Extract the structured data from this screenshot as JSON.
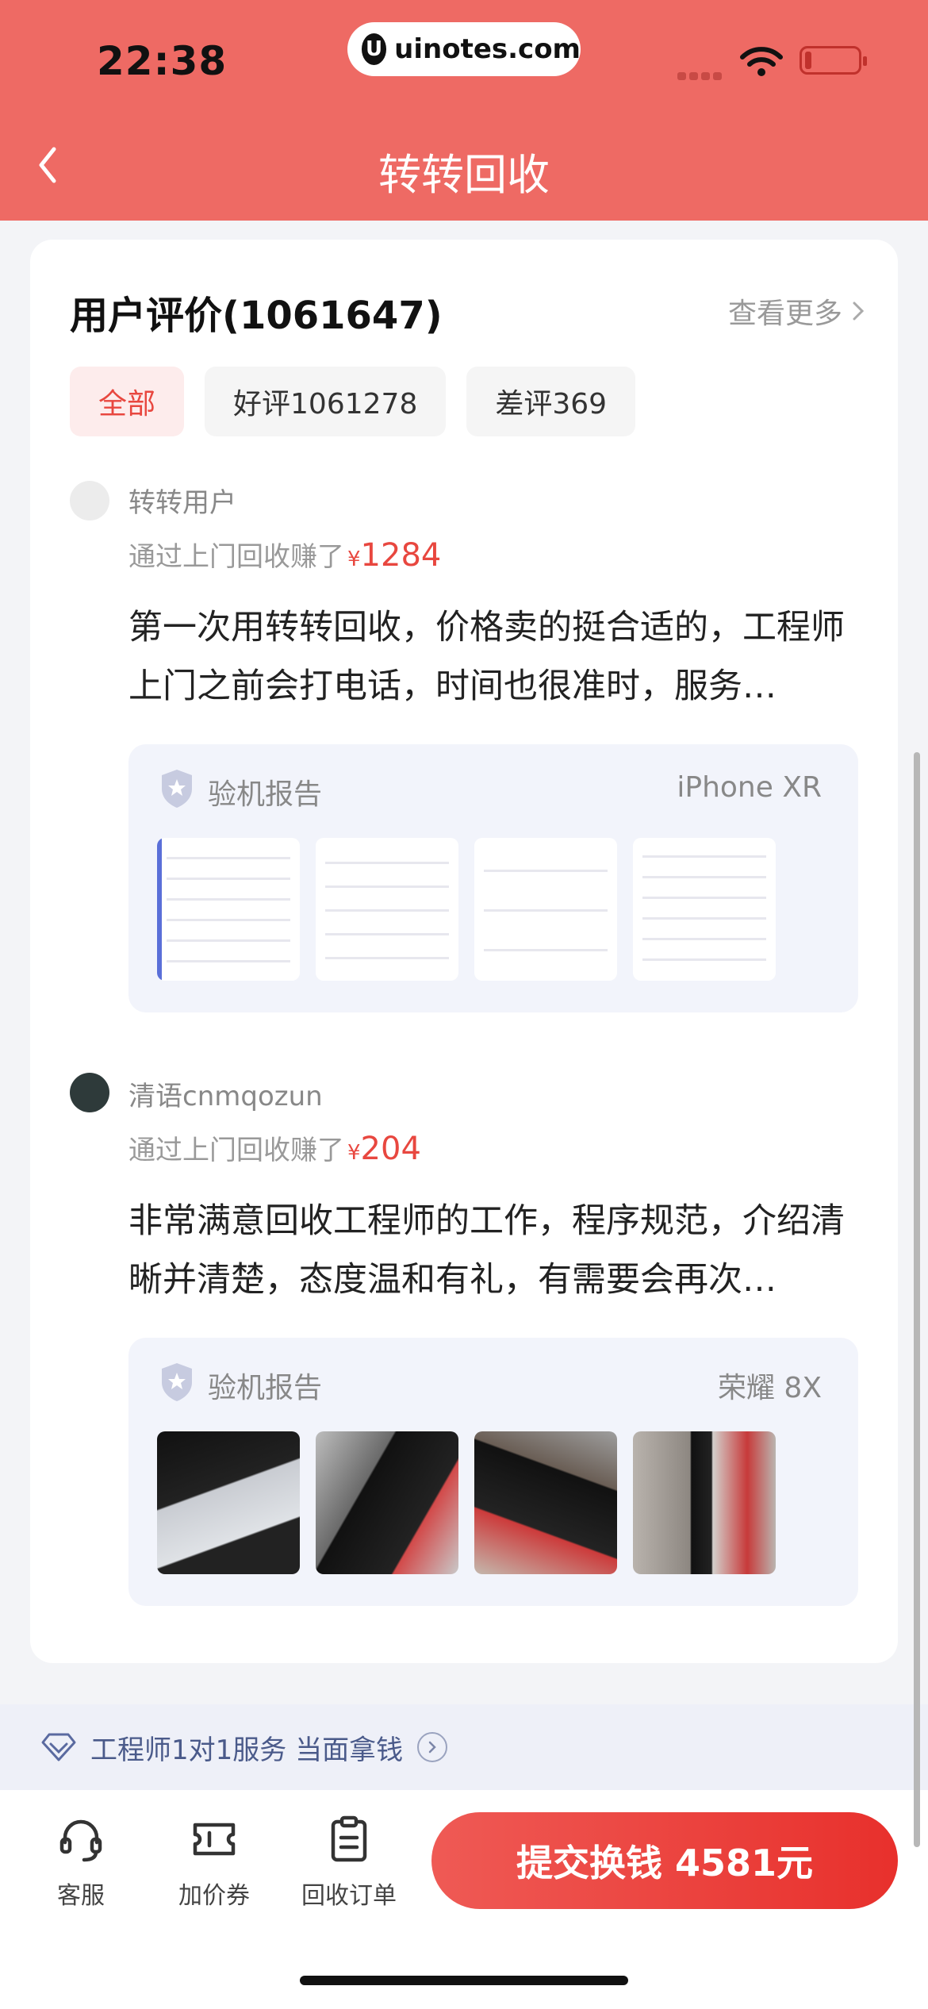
{
  "status": {
    "time": "22:38",
    "url": "uinotes.com"
  },
  "nav": {
    "title": "转转回收"
  },
  "reviews_section": {
    "title": "用户评价(1061647)",
    "see_more": "查看更多",
    "tabs": [
      {
        "label": "全部",
        "active": true
      },
      {
        "label": "好评1061278",
        "active": false
      },
      {
        "label": "差评369",
        "active": false
      }
    ],
    "items": [
      {
        "user": "转转用户",
        "earn_prefix": "通过上门回收赚了",
        "currency": "¥",
        "amount": "1284",
        "text": "第一次用转转回收，价格卖的挺合适的，工程师上门之前会打电话，时间也很准时，服务…",
        "report_label": "验机报告",
        "report_model": "iPhone XR"
      },
      {
        "user": "清语cnmqozun",
        "earn_prefix": "通过上门回收赚了",
        "currency": "¥",
        "amount": "204",
        "text": "非常满意回收工程师的工作，程序规范，介绍清晰并清楚，态度温和有礼，有需要会再次…",
        "report_label": "验机报告",
        "report_model": "荣耀 8X"
      }
    ]
  },
  "promo": {
    "text": "工程师1对1服务 当面拿钱"
  },
  "bottom_bar": {
    "customer_service": "客服",
    "coupon": "加价券",
    "orders": "回收订单",
    "submit": "提交换钱 4581元"
  },
  "colors": {
    "header": "#ee6a64",
    "accent": "#e8473f",
    "submit": "#e8302c"
  },
  "icons": [
    "back-chevron-icon",
    "chevron-right-icon",
    "shield-star-icon",
    "diamond-icon",
    "headset-icon",
    "coupon-icon",
    "clipboard-icon",
    "wifi-icon",
    "battery-icon"
  ]
}
